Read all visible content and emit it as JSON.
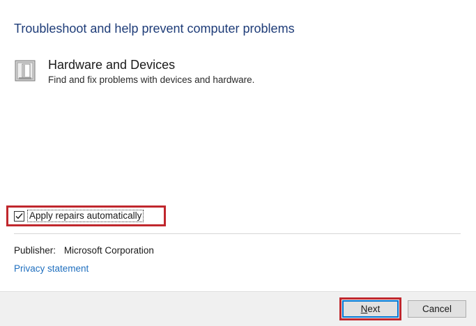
{
  "dialog": {
    "heading": "Troubleshoot and help prevent computer problems"
  },
  "troubleshooter": {
    "icon": "hardware-device-icon",
    "title": "Hardware and Devices",
    "description": "Find and fix problems with devices and hardware."
  },
  "options": {
    "apply_repairs_label": "Apply repairs automatically",
    "apply_repairs_checked": true
  },
  "publisher": {
    "label": "Publisher:",
    "value": "Microsoft Corporation"
  },
  "links": {
    "privacy": "Privacy statement"
  },
  "buttons": {
    "next_mnemonic": "N",
    "next_rest": "ext",
    "cancel": "Cancel"
  },
  "colors": {
    "heading": "#1e3c78",
    "link": "#1f6fbf",
    "highlight": "#c0272d",
    "footer_bg": "#f0f0f0"
  }
}
